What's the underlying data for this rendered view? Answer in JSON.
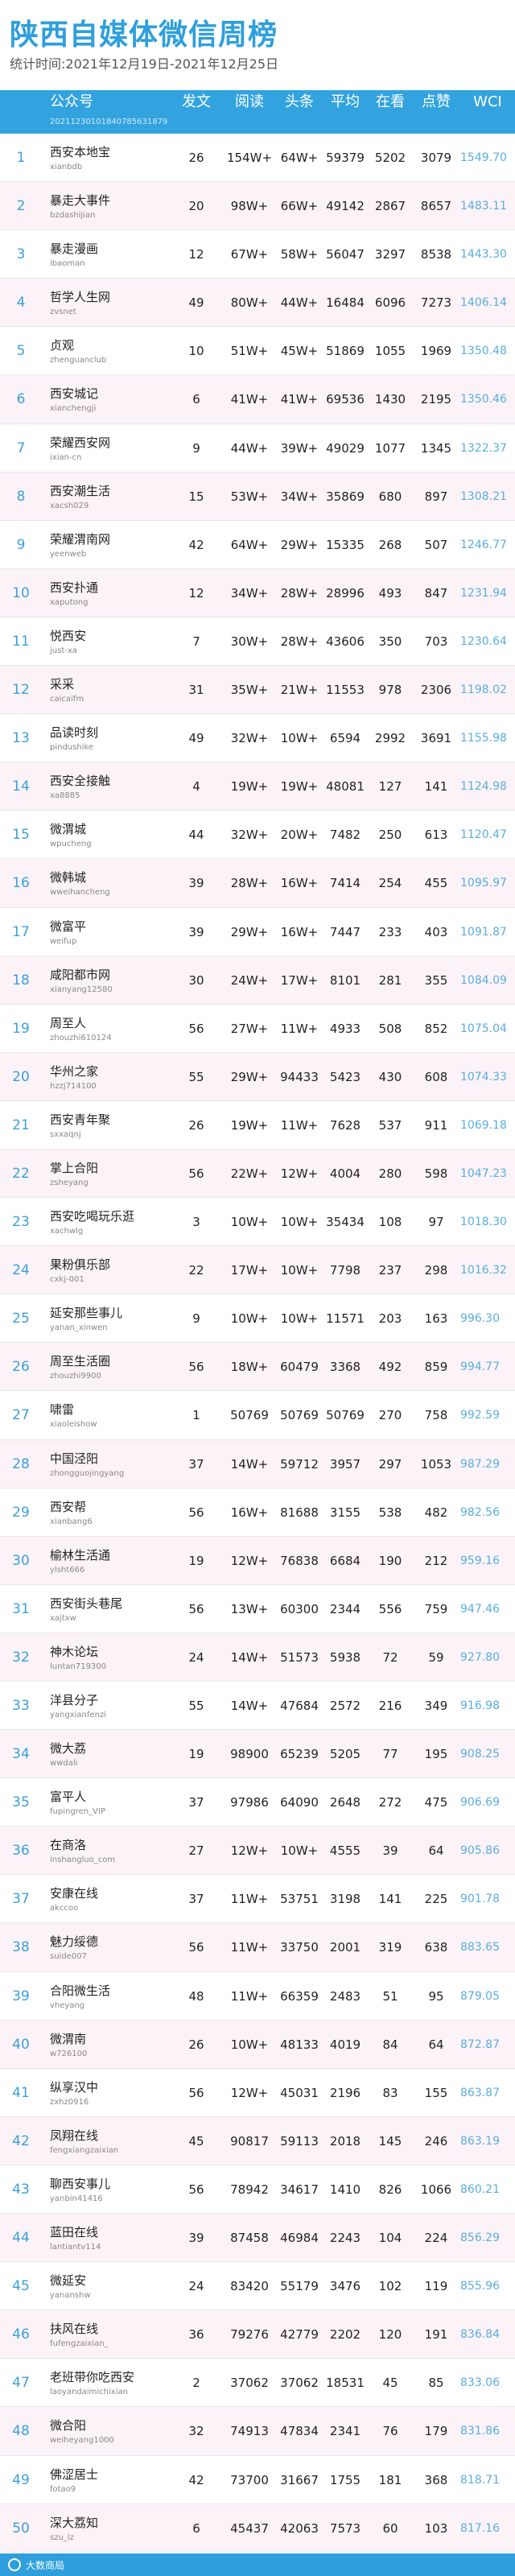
{
  "header": {
    "title": "陕西自媒体微信周榜",
    "subtitle": "统计时间:2021年12月19日-2021年12月25日"
  },
  "columns": {
    "account": "公众号",
    "account_sub": "20211230101840785631879",
    "posts": "发文",
    "reads": "阅读",
    "headline": "头条",
    "average": "平均",
    "looking": "在看",
    "likes": "点赞",
    "wci": "WCI"
  },
  "rows": [
    {
      "rank": "1",
      "name": "西安本地宝",
      "id": "xianbdb",
      "posts": "26",
      "reads": "154W+",
      "headline": "64W+",
      "average": "59379",
      "looking": "5202",
      "likes": "3079",
      "wci": "1549.70"
    },
    {
      "rank": "2",
      "name": "暴走大事件",
      "id": "bzdashijian",
      "posts": "20",
      "reads": "98W+",
      "headline": "66W+",
      "average": "49142",
      "looking": "2867",
      "likes": "8657",
      "wci": "1483.11"
    },
    {
      "rank": "3",
      "name": "暴走漫画",
      "id": "ibaoman",
      "posts": "12",
      "reads": "67W+",
      "headline": "58W+",
      "average": "56047",
      "looking": "3297",
      "likes": "8538",
      "wci": "1443.30"
    },
    {
      "rank": "4",
      "name": "哲学人生网",
      "id": "zvsnet",
      "posts": "49",
      "reads": "80W+",
      "headline": "44W+",
      "average": "16484",
      "looking": "6096",
      "likes": "7273",
      "wci": "1406.14"
    },
    {
      "rank": "5",
      "name": "贞观",
      "id": "zhenguanclub",
      "posts": "10",
      "reads": "51W+",
      "headline": "45W+",
      "average": "51869",
      "looking": "1055",
      "likes": "1969",
      "wci": "1350.48"
    },
    {
      "rank": "6",
      "name": "西安城记",
      "id": "xianchengji",
      "posts": "6",
      "reads": "41W+",
      "headline": "41W+",
      "average": "69536",
      "looking": "1430",
      "likes": "2195",
      "wci": "1350.46"
    },
    {
      "rank": "7",
      "name": "荣耀西安网",
      "id": "ixian-cn",
      "posts": "9",
      "reads": "44W+",
      "headline": "39W+",
      "average": "49029",
      "looking": "1077",
      "likes": "1345",
      "wci": "1322.37"
    },
    {
      "rank": "8",
      "name": "西安潮生活",
      "id": "xacsh029",
      "posts": "15",
      "reads": "53W+",
      "headline": "34W+",
      "average": "35869",
      "looking": "680",
      "likes": "897",
      "wci": "1308.21"
    },
    {
      "rank": "9",
      "name": "荣耀渭南网",
      "id": "yeenweb",
      "posts": "42",
      "reads": "64W+",
      "headline": "29W+",
      "average": "15335",
      "looking": "268",
      "likes": "507",
      "wci": "1246.77"
    },
    {
      "rank": "10",
      "name": "西安扑通",
      "id": "xaputong",
      "posts": "12",
      "reads": "34W+",
      "headline": "28W+",
      "average": "28996",
      "looking": "493",
      "likes": "847",
      "wci": "1231.94"
    },
    {
      "rank": "11",
      "name": "悦西安",
      "id": "just-xa",
      "posts": "7",
      "reads": "30W+",
      "headline": "28W+",
      "average": "43606",
      "looking": "350",
      "likes": "703",
      "wci": "1230.64"
    },
    {
      "rank": "12",
      "name": "采采",
      "id": "caicaifm",
      "posts": "31",
      "reads": "35W+",
      "headline": "21W+",
      "average": "11553",
      "looking": "978",
      "likes": "2306",
      "wci": "1198.02"
    },
    {
      "rank": "13",
      "name": "品读时刻",
      "id": "pindushike",
      "posts": "49",
      "reads": "32W+",
      "headline": "10W+",
      "average": "6594",
      "looking": "2992",
      "likes": "3691",
      "wci": "1155.98"
    },
    {
      "rank": "14",
      "name": "西安全接触",
      "id": "xa8885",
      "posts": "4",
      "reads": "19W+",
      "headline": "19W+",
      "average": "48081",
      "looking": "127",
      "likes": "141",
      "wci": "1124.98"
    },
    {
      "rank": "15",
      "name": "微渭城",
      "id": "wpucheng",
      "posts": "44",
      "reads": "32W+",
      "headline": "20W+",
      "average": "7482",
      "looking": "250",
      "likes": "613",
      "wci": "1120.47"
    },
    {
      "rank": "16",
      "name": "微韩城",
      "id": "wweihancheng",
      "posts": "39",
      "reads": "28W+",
      "headline": "16W+",
      "average": "7414",
      "looking": "254",
      "likes": "455",
      "wci": "1095.97"
    },
    {
      "rank": "17",
      "name": "微富平",
      "id": "weifup",
      "posts": "39",
      "reads": "29W+",
      "headline": "16W+",
      "average": "7447",
      "looking": "233",
      "likes": "403",
      "wci": "1091.87"
    },
    {
      "rank": "18",
      "name": "咸阳都市网",
      "id": "xianyang12580",
      "posts": "30",
      "reads": "24W+",
      "headline": "17W+",
      "average": "8101",
      "looking": "281",
      "likes": "355",
      "wci": "1084.09"
    },
    {
      "rank": "19",
      "name": "周至人",
      "id": "zhouzhi610124",
      "posts": "56",
      "reads": "27W+",
      "headline": "11W+",
      "average": "4933",
      "looking": "508",
      "likes": "852",
      "wci": "1075.04"
    },
    {
      "rank": "20",
      "name": "华州之家",
      "id": "hzzj714100",
      "posts": "55",
      "reads": "29W+",
      "headline": "94433",
      "average": "5423",
      "looking": "430",
      "likes": "608",
      "wci": "1074.33"
    },
    {
      "rank": "21",
      "name": "西安青年聚",
      "id": "sxxaqnj",
      "posts": "26",
      "reads": "19W+",
      "headline": "11W+",
      "average": "7628",
      "looking": "537",
      "likes": "911",
      "wci": "1069.18"
    },
    {
      "rank": "22",
      "name": "掌上合阳",
      "id": "zsheyang",
      "posts": "56",
      "reads": "22W+",
      "headline": "12W+",
      "average": "4004",
      "looking": "280",
      "likes": "598",
      "wci": "1047.23"
    },
    {
      "rank": "23",
      "name": "西安吃喝玩乐逛",
      "id": "xachwlg",
      "posts": "3",
      "reads": "10W+",
      "headline": "10W+",
      "average": "35434",
      "looking": "108",
      "likes": "97",
      "wci": "1018.30"
    },
    {
      "rank": "24",
      "name": "果粉俱乐部",
      "id": "cxkj-001",
      "posts": "22",
      "reads": "17W+",
      "headline": "10W+",
      "average": "7798",
      "looking": "237",
      "likes": "298",
      "wci": "1016.32"
    },
    {
      "rank": "25",
      "name": "延安那些事儿",
      "id": "yanan_xinwen",
      "posts": "9",
      "reads": "10W+",
      "headline": "10W+",
      "average": "11571",
      "looking": "203",
      "likes": "163",
      "wci": "996.30"
    },
    {
      "rank": "26",
      "name": "周至生活圈",
      "id": "zhouzhi9900",
      "posts": "56",
      "reads": "18W+",
      "headline": "60479",
      "average": "3368",
      "looking": "492",
      "likes": "859",
      "wci": "994.77"
    },
    {
      "rank": "27",
      "name": "啸雷",
      "id": "xiaoleishow",
      "posts": "1",
      "reads": "50769",
      "headline": "50769",
      "average": "50769",
      "looking": "270",
      "likes": "758",
      "wci": "992.59"
    },
    {
      "rank": "28",
      "name": "中国泾阳",
      "id": "zhongguojingyang",
      "posts": "37",
      "reads": "14W+",
      "headline": "59712",
      "average": "3957",
      "looking": "297",
      "likes": "1053",
      "wci": "987.29"
    },
    {
      "rank": "29",
      "name": "西安帮",
      "id": "xianbang6",
      "posts": "56",
      "reads": "16W+",
      "headline": "81688",
      "average": "3155",
      "looking": "538",
      "likes": "482",
      "wci": "982.56"
    },
    {
      "rank": "30",
      "name": "榆林生活通",
      "id": "ylsht666",
      "posts": "19",
      "reads": "12W+",
      "headline": "76838",
      "average": "6684",
      "looking": "190",
      "likes": "212",
      "wci": "959.16"
    },
    {
      "rank": "31",
      "name": "西安街头巷尾",
      "id": "xajtxw",
      "posts": "56",
      "reads": "13W+",
      "headline": "60300",
      "average": "2344",
      "looking": "556",
      "likes": "759",
      "wci": "947.46"
    },
    {
      "rank": "32",
      "name": "神木论坛",
      "id": "luntan719300",
      "posts": "24",
      "reads": "14W+",
      "headline": "51573",
      "average": "5938",
      "looking": "72",
      "likes": "59",
      "wci": "927.80"
    },
    {
      "rank": "33",
      "name": "洋县分子",
      "id": "yangxianfenzi",
      "posts": "55",
      "reads": "14W+",
      "headline": "47684",
      "average": "2572",
      "looking": "216",
      "likes": "349",
      "wci": "916.98"
    },
    {
      "rank": "34",
      "name": "微大荔",
      "id": "wwdali",
      "posts": "19",
      "reads": "98900",
      "headline": "65239",
      "average": "5205",
      "looking": "77",
      "likes": "195",
      "wci": "908.25"
    },
    {
      "rank": "35",
      "name": "富平人",
      "id": "fupingren_VIP",
      "posts": "37",
      "reads": "97986",
      "headline": "64090",
      "average": "2648",
      "looking": "272",
      "likes": "475",
      "wci": "906.69"
    },
    {
      "rank": "36",
      "name": "在商洛",
      "id": "inshangluo_com",
      "posts": "27",
      "reads": "12W+",
      "headline": "10W+",
      "average": "4555",
      "looking": "39",
      "likes": "64",
      "wci": "905.86"
    },
    {
      "rank": "37",
      "name": "安康在线",
      "id": "akccoo",
      "posts": "37",
      "reads": "11W+",
      "headline": "53751",
      "average": "3198",
      "looking": "141",
      "likes": "225",
      "wci": "901.78"
    },
    {
      "rank": "38",
      "name": "魅力绥德",
      "id": "suide007",
      "posts": "56",
      "reads": "11W+",
      "headline": "33750",
      "average": "2001",
      "looking": "319",
      "likes": "638",
      "wci": "883.65"
    },
    {
      "rank": "39",
      "name": "合阳微生活",
      "id": "vheyang",
      "posts": "48",
      "reads": "11W+",
      "headline": "66359",
      "average": "2483",
      "looking": "51",
      "likes": "95",
      "wci": "879.05"
    },
    {
      "rank": "40",
      "name": "微渭南",
      "id": "w726100",
      "posts": "26",
      "reads": "10W+",
      "headline": "48133",
      "average": "4019",
      "looking": "84",
      "likes": "64",
      "wci": "872.87"
    },
    {
      "rank": "41",
      "name": "纵享汉中",
      "id": "zxhz0916",
      "posts": "56",
      "reads": "12W+",
      "headline": "45031",
      "average": "2196",
      "looking": "83",
      "likes": "155",
      "wci": "863.87"
    },
    {
      "rank": "42",
      "name": "凤翔在线",
      "id": "fengxiangzaixian",
      "posts": "45",
      "reads": "90817",
      "headline": "59113",
      "average": "2018",
      "looking": "145",
      "likes": "246",
      "wci": "863.19"
    },
    {
      "rank": "43",
      "name": "聊西安事儿",
      "id": "yanbin41416",
      "posts": "56",
      "reads": "78942",
      "headline": "34617",
      "average": "1410",
      "looking": "826",
      "likes": "1066",
      "wci": "860.21"
    },
    {
      "rank": "44",
      "name": "蓝田在线",
      "id": "lantiantv114",
      "posts": "39",
      "reads": "87458",
      "headline": "46984",
      "average": "2243",
      "looking": "104",
      "likes": "224",
      "wci": "856.29"
    },
    {
      "rank": "45",
      "name": "微延安",
      "id": "yananshw",
      "posts": "24",
      "reads": "83420",
      "headline": "55179",
      "average": "3476",
      "looking": "102",
      "likes": "119",
      "wci": "855.96"
    },
    {
      "rank": "46",
      "name": "扶风在线",
      "id": "fufengzaixian_",
      "posts": "36",
      "reads": "79276",
      "headline": "42779",
      "average": "2202",
      "looking": "120",
      "likes": "191",
      "wci": "836.84"
    },
    {
      "rank": "47",
      "name": "老班带你吃西安",
      "id": "laoyandaimichixian",
      "posts": "2",
      "reads": "37062",
      "headline": "37062",
      "average": "18531",
      "looking": "45",
      "likes": "85",
      "wci": "833.06"
    },
    {
      "rank": "48",
      "name": "微合阳",
      "id": "weiheyang1000",
      "posts": "32",
      "reads": "74913",
      "headline": "47834",
      "average": "2341",
      "looking": "76",
      "likes": "179",
      "wci": "831.86"
    },
    {
      "rank": "49",
      "name": "佛涩居士",
      "id": "fotao9",
      "posts": "42",
      "reads": "73700",
      "headline": "31667",
      "average": "1755",
      "looking": "181",
      "likes": "368",
      "wci": "818.71"
    },
    {
      "rank": "50",
      "name": "深大荔知",
      "id": "szu_lz",
      "posts": "6",
      "reads": "45437",
      "headline": "42063",
      "average": "7573",
      "looking": "60",
      "likes": "103",
      "wci": "817.16"
    }
  ],
  "footer": {
    "text": "大数商局"
  },
  "colors": {
    "accent": "#2e9fdc",
    "header_bar": "#33a3e0",
    "stripe": "#fbf3f7",
    "wci_text": "#5aaee0"
  }
}
